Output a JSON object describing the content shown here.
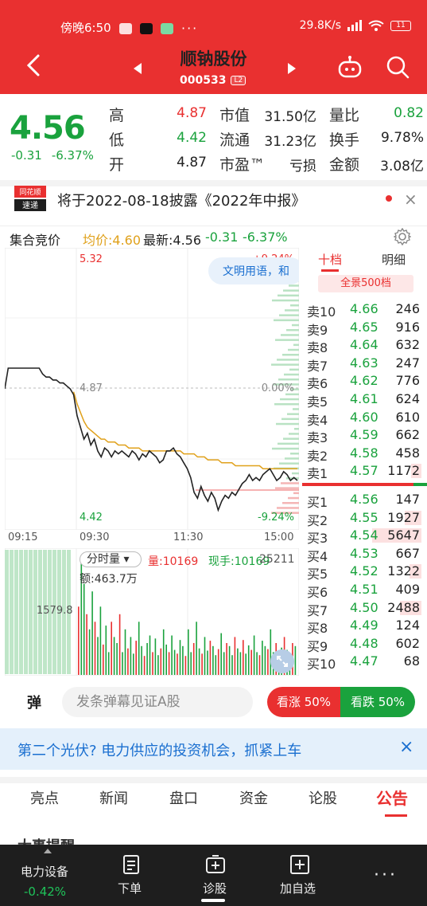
{
  "status_bar": {
    "time": "傍晚6:50",
    "net_speed": "29.8K/s",
    "battery": "11",
    "more_dots": "···"
  },
  "header": {
    "stock_name": "顺钠股份",
    "stock_code": "000533",
    "board_tag": "L2"
  },
  "quote": {
    "price": "4.56",
    "change": "-0.31",
    "change_pct": "-6.37%",
    "high_label": "高",
    "high": "4.87",
    "low_label": "低",
    "low": "4.42",
    "open_label": "开",
    "open": "4.87",
    "mcap_label": "市值",
    "mcap": "31.50亿",
    "float_label": "流通",
    "float": "31.23亿",
    "pe_label": "市盈™",
    "pe": "亏损",
    "vol_ratio_label": "量比",
    "vol_ratio": "0.82",
    "turnover_label": "换手",
    "turnover": "9.78%",
    "amount_label": "金额",
    "amount": "3.08亿"
  },
  "announcement": {
    "logo_top": "同花顺",
    "logo_bottom": "速递",
    "text": "将于2022-08-18披露《2022年中报》",
    "close": "×"
  },
  "chart_header": {
    "auction": "集合竞价",
    "avg_label": "均价:4.60",
    "latest_label": "最新:4.56",
    "change": "-0.31",
    "change_pct": "-6.37%"
  },
  "chart_labels": {
    "high_price": "5.32",
    "high_pct": "+9.24%",
    "mid_price": "4.87",
    "mid_pct": "0.00%",
    "low_price": "4.42",
    "low_pct": "-9.24%",
    "tooltip": "文明用语，和"
  },
  "chart_data": {
    "type": "line",
    "x_ticks": [
      "09:15",
      "09:30",
      "11:30",
      "15:00"
    ],
    "ylim": [
      4.42,
      5.32
    ],
    "prev_close": 4.87,
    "series": [
      {
        "name": "",
        "values": [
          4.87,
          4.94,
          4.94,
          4.94,
          4.94,
          4.94,
          4.94,
          4.94,
          4.94,
          4.94,
          4.94,
          4.92,
          4.91,
          4.91,
          4.9,
          4.9,
          4.89,
          4.89,
          4.88,
          4.87,
          4.85,
          4.78,
          4.74,
          4.7,
          4.72,
          4.68,
          4.7,
          4.66,
          4.64,
          4.67,
          4.66,
          4.64,
          4.66,
          4.65,
          4.66,
          4.65,
          4.64,
          4.66,
          4.65,
          4.63,
          4.65,
          4.64,
          4.66,
          4.65,
          4.64,
          4.62,
          4.63,
          4.66,
          4.66,
          4.67,
          4.65,
          4.64,
          4.62,
          4.6,
          4.57,
          4.52,
          4.5,
          4.54,
          4.51,
          4.49,
          4.52,
          4.5,
          4.46,
          4.49,
          4.51,
          4.5,
          4.52,
          4.51,
          4.53,
          4.55,
          4.56,
          4.58,
          4.56,
          4.57,
          4.56,
          4.58,
          4.59,
          4.6,
          4.58,
          4.56,
          4.57,
          4.59,
          4.58,
          4.56,
          4.57,
          4.56
        ]
      },
      {
        "name": "",
        "values": [
          4.87,
          4.94,
          4.94,
          4.94,
          4.94,
          4.94,
          4.94,
          4.94,
          4.94,
          4.94,
          4.94,
          4.93,
          4.92,
          4.92,
          4.91,
          4.91,
          4.9,
          4.9,
          4.89,
          4.88,
          4.86,
          4.82,
          4.79,
          4.76,
          4.74,
          4.73,
          4.72,
          4.71,
          4.7,
          4.7,
          4.69,
          4.69,
          4.69,
          4.68,
          4.68,
          4.68,
          4.67,
          4.67,
          4.67,
          4.67,
          4.66,
          4.66,
          4.66,
          4.66,
          4.66,
          4.66,
          4.66,
          4.66,
          4.66,
          4.66,
          4.66,
          4.66,
          4.65,
          4.65,
          4.65,
          4.65,
          4.64,
          4.64,
          4.64,
          4.63,
          4.63,
          4.63,
          4.63,
          4.62,
          4.62,
          4.62,
          4.62,
          4.61,
          4.61,
          4.61,
          4.61,
          4.61,
          4.61,
          4.61,
          4.61,
          4.6,
          4.6,
          4.6,
          4.6,
          4.6,
          4.6,
          4.6,
          4.6,
          4.6,
          4.6,
          4.6
        ]
      }
    ]
  },
  "volume": {
    "selector": "分时量",
    "vol_label": "量:10169",
    "cur_label": "现手:10169",
    "amount_label": "额:463.7万",
    "max_label": "1579.8",
    "right_val": "25211",
    "bars": [
      900,
      1579,
      1200,
      800,
      600,
      1100,
      700,
      500,
      900,
      400,
      650,
      300,
      700,
      500,
      420,
      800,
      300,
      600,
      350,
      500,
      280,
      450,
      700,
      380,
      250,
      420,
      520,
      300,
      480,
      260,
      350,
      600,
      400,
      300,
      520,
      330,
      280,
      460,
      380,
      250,
      600,
      300,
      420,
      700,
      350,
      280,
      500,
      320,
      450,
      380,
      260,
      340,
      550,
      300,
      420,
      380,
      260,
      500,
      350,
      300,
      460,
      280,
      390,
      330,
      520,
      300,
      260,
      450,
      380,
      340,
      600,
      300,
      420,
      280,
      360,
      500,
      330,
      270,
      420,
      380
    ]
  },
  "orderbook": {
    "tab_active": "十档",
    "tab_other": "明细",
    "full_btn": "全景500档",
    "asks": [
      {
        "label": "卖10",
        "price": "4.66",
        "qty": "246"
      },
      {
        "label": "卖9",
        "price": "4.65",
        "qty": "916"
      },
      {
        "label": "卖8",
        "price": "4.64",
        "qty": "632"
      },
      {
        "label": "卖7",
        "price": "4.63",
        "qty": "247"
      },
      {
        "label": "卖6",
        "price": "4.62",
        "qty": "776"
      },
      {
        "label": "卖5",
        "price": "4.61",
        "qty": "624"
      },
      {
        "label": "卖4",
        "price": "4.60",
        "qty": "610"
      },
      {
        "label": "卖3",
        "price": "4.59",
        "qty": "662"
      },
      {
        "label": "卖2",
        "price": "4.58",
        "qty": "458"
      },
      {
        "label": "卖1",
        "price": "4.57",
        "qty": "1172"
      }
    ],
    "bids": [
      {
        "label": "买1",
        "price": "4.56",
        "qty": "147"
      },
      {
        "label": "买2",
        "price": "4.55",
        "qty": "1927"
      },
      {
        "label": "买3",
        "price": "4.54",
        "qty": "5647"
      },
      {
        "label": "买4",
        "price": "4.53",
        "qty": "667"
      },
      {
        "label": "买5",
        "price": "4.52",
        "qty": "1322"
      },
      {
        "label": "买6",
        "price": "4.51",
        "qty": "409"
      },
      {
        "label": "买7",
        "price": "4.50",
        "qty": "2488"
      },
      {
        "label": "买8",
        "price": "4.49",
        "qty": "124"
      },
      {
        "label": "买9",
        "price": "4.48",
        "qty": "602"
      },
      {
        "label": "买10",
        "price": "4.47",
        "qty": "68"
      }
    ]
  },
  "danmu": {
    "icon": "弹",
    "placeholder": "发条弹幕见证A股",
    "up": "看涨 50%",
    "down": "看跌 50%"
  },
  "ad": {
    "text": "第二个光伏? 电力供应的投资机会，抓紧上车",
    "close": "×"
  },
  "bottom_tabs": [
    "亮点",
    "新闻",
    "盘口",
    "资金",
    "论股",
    "公告"
  ],
  "peek": "大事提醒",
  "nav": {
    "sector": "电力设备",
    "sector_pct": "-0.42%",
    "items": [
      "下单",
      "诊股",
      "加自选"
    ],
    "more": "···"
  },
  "colors": {
    "brand_red": "#e93030",
    "down_green": "#1aa23d",
    "avg_line": "#e0a11b"
  }
}
